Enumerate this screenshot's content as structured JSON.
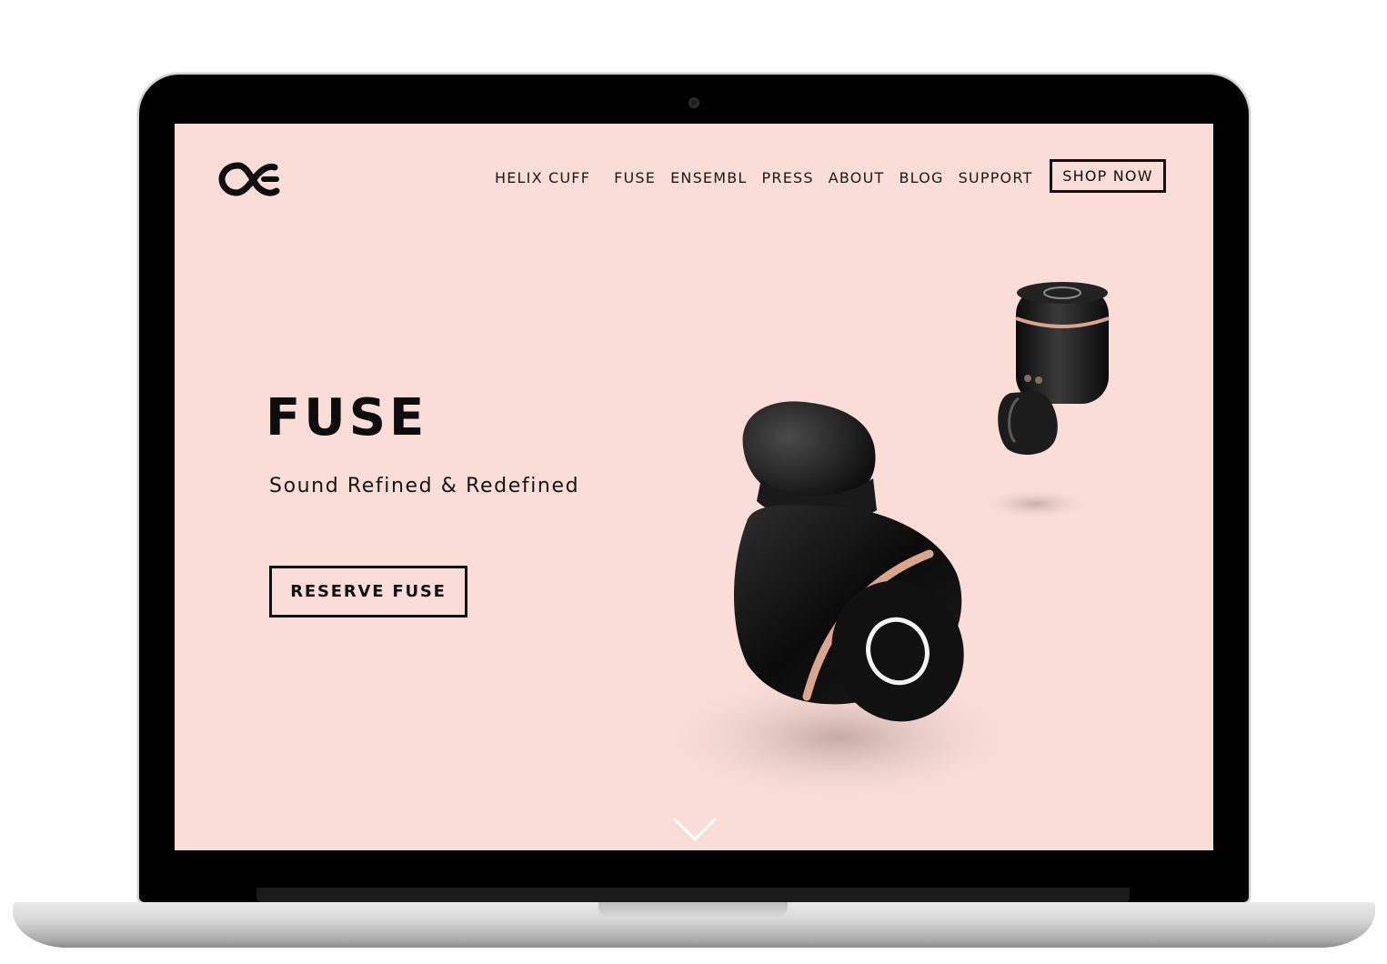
{
  "site": {
    "logo_icon": "oc-infinity-logo",
    "nav": {
      "items": [
        {
          "label": "HELIX CUFF"
        },
        {
          "label": "FUSE"
        },
        {
          "label": "ENSEMBL"
        },
        {
          "label": "PRESS"
        },
        {
          "label": "ABOUT"
        },
        {
          "label": "BLOG"
        },
        {
          "label": "SUPPORT"
        }
      ],
      "shop_label": "SHOP NOW"
    },
    "hero": {
      "title": "FUSE",
      "subtitle": "Sound Refined & Redefined",
      "cta_label": "RESERVE FUSE"
    },
    "scroll_icon": "chevron-down-icon"
  },
  "colors": {
    "background": "#f9ddd6",
    "text": "#111111",
    "earbud": "#141414",
    "accent_ring": "#d9a58c"
  }
}
